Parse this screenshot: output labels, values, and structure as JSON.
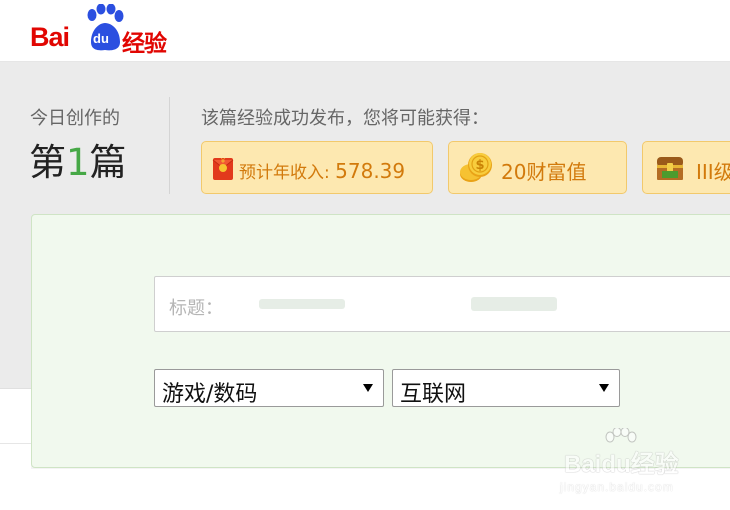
{
  "logo": {
    "bai": "Bai",
    "du": "du",
    "jingyan": "经验"
  },
  "stats": {
    "today_label": "今日创作的",
    "count_prefix": "第",
    "count_number": "1",
    "count_suffix": "篇"
  },
  "rewards": {
    "title": "该篇经验成功发布，您将可能获得：",
    "items": [
      {
        "icon": "red-envelope-icon",
        "label": "预计年收入:",
        "value": "578.39"
      },
      {
        "icon": "gold-coin-icon",
        "label": "20财富值"
      },
      {
        "icon": "treasure-chest-icon",
        "label": "III级"
      }
    ]
  },
  "form": {
    "title_label": "标题：",
    "category_1": "游戏/数码",
    "category_2": "互联网"
  },
  "watermark": {
    "text": "Baidu经验",
    "url": "jingyan.baidu.com"
  },
  "colors": {
    "brand_red": "#e10602",
    "count_green": "#46a846",
    "chip_text": "#d27a0c",
    "chip_bg": "#fde8b0",
    "panel_bg": "#f1f9ee"
  }
}
